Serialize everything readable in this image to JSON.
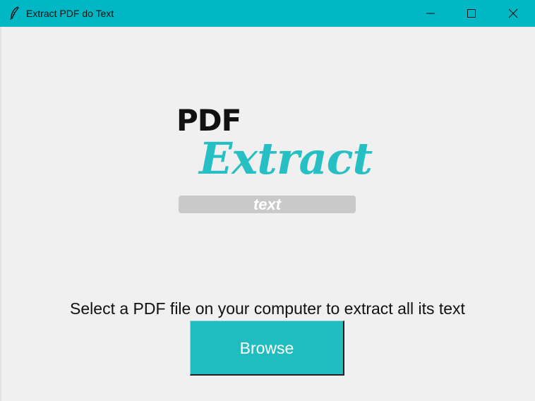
{
  "window": {
    "title": "Extract PDF do Text",
    "app_icon": "feather-icon",
    "titlebar_color": "#00b7c3",
    "controls": {
      "minimize_icon": "minimize-icon",
      "maximize_icon": "maximize-icon",
      "close_icon": "close-icon"
    }
  },
  "logo": {
    "line1": "PDF",
    "line2": "Extract",
    "line3": "text",
    "accent_color": "#26bfc4",
    "bar_color": "#c9c9c9"
  },
  "main": {
    "instruction": "Select a PDF file on your computer to extract all its text",
    "browse_label": "Browse",
    "button_color": "#20bcbf"
  }
}
